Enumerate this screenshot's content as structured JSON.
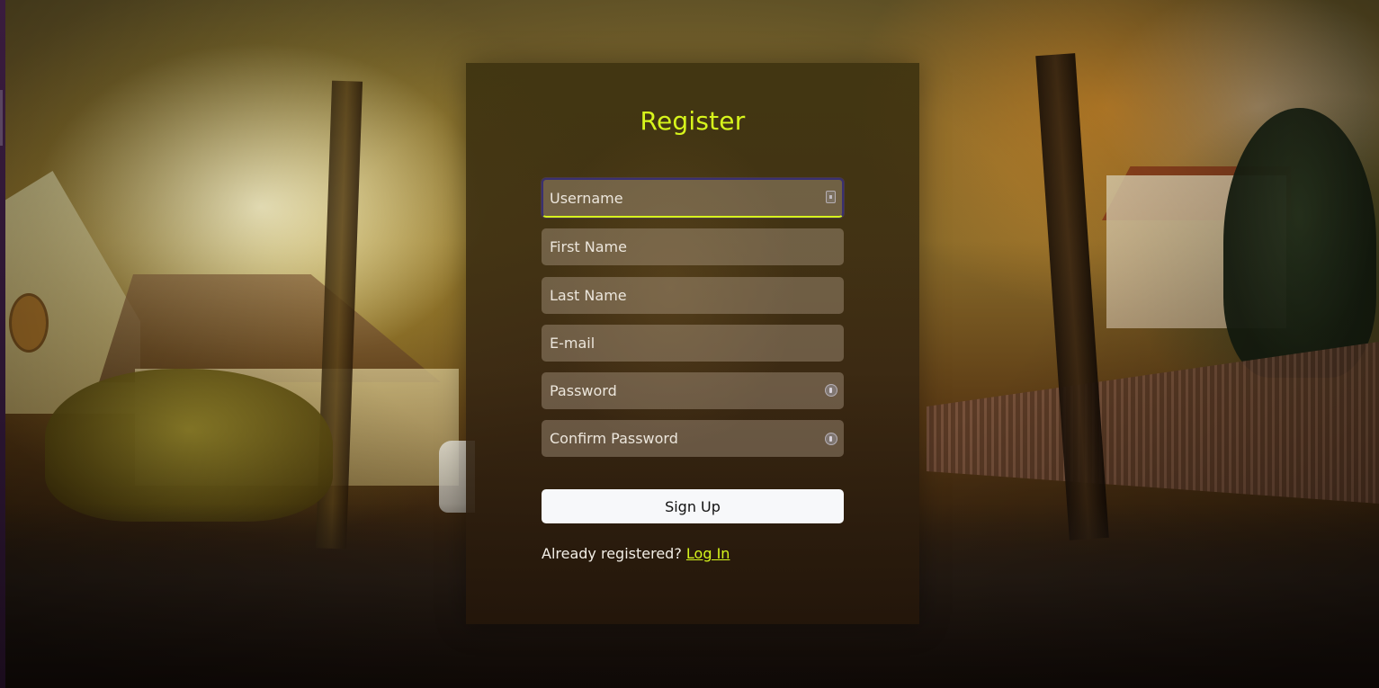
{
  "form": {
    "title": "Register",
    "fields": {
      "username": {
        "placeholder": "Username",
        "icon": "id-card-icon"
      },
      "first_name": {
        "placeholder": "First Name"
      },
      "last_name": {
        "placeholder": "Last Name"
      },
      "email": {
        "placeholder": "E-mail"
      },
      "password": {
        "placeholder": "Password",
        "icon": "key-icon"
      },
      "confirm_password": {
        "placeholder": "Confirm Password",
        "icon": "key-icon"
      }
    },
    "submit_label": "Sign Up",
    "footer": {
      "text": "Already registered?",
      "link_label": "Log In"
    }
  },
  "colors": {
    "accent": "#d7f51c",
    "button_bg": "#f7f8fa",
    "text": "#f2eee6"
  }
}
